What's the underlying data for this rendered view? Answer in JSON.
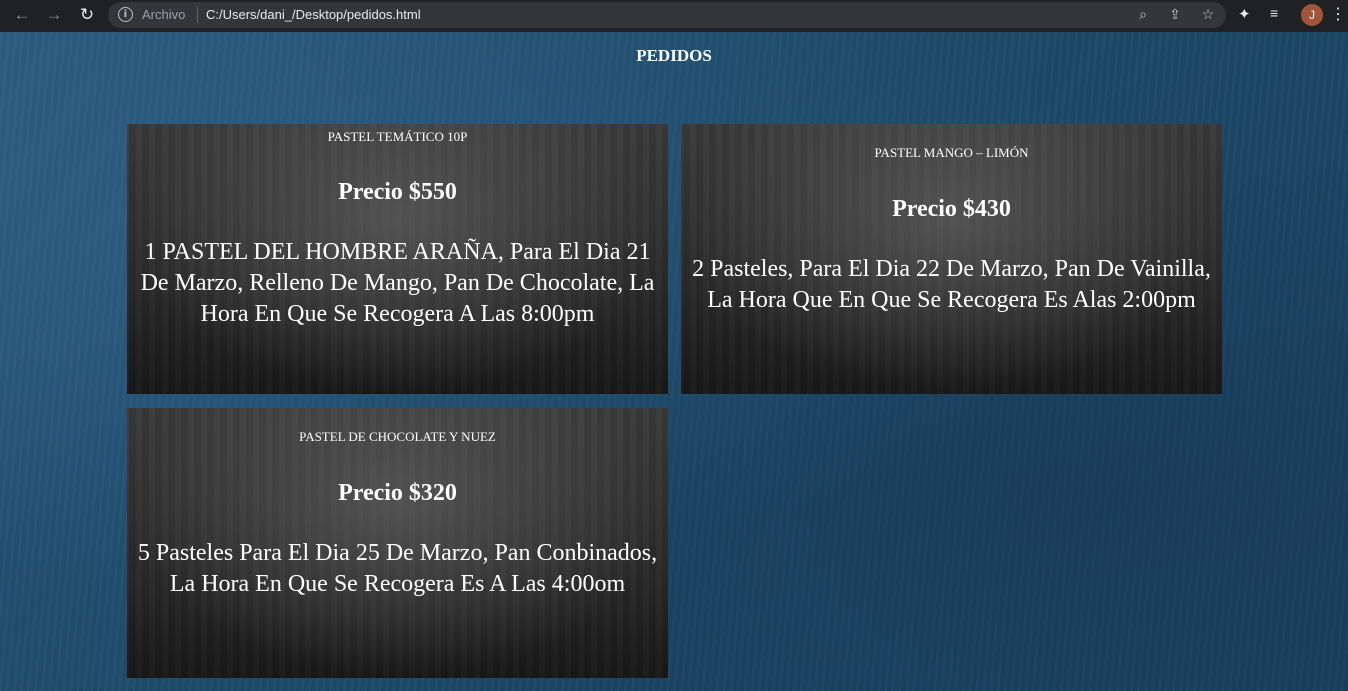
{
  "browser": {
    "back_icon": "←",
    "forward_icon": "→",
    "reload_icon": "↻",
    "info_icon": "i",
    "scheme_label": "Archivo",
    "url": "C:/Users/dani_/Desktop/pedidos.html",
    "zoom_icon": "⌕",
    "share_icon": "⇪",
    "star_icon": "☆",
    "extensions_icon": "✦",
    "media_icon": "≡",
    "avatar_letter": "J",
    "menu_icon": "⋮"
  },
  "page": {
    "title": "PEDIDOS"
  },
  "orders": [
    {
      "title": "PASTEL TEMÁTICO 10P",
      "price": "Precio $550",
      "description": "1 PASTEL DEL HOMBRE ARAÑA, Para El Dia 21 De Marzo, Relleno De Mango, Pan De Chocolate, La Hora En Que Se Recogera A Las 8:00pm"
    },
    {
      "title": "PASTEL MANGO – LIMÓN",
      "price": "Precio $430",
      "description": "2 Pasteles, Para El Dia 22 De Marzo, Pan De Vainilla, La Hora Que En Que Se Recogera Es Alas 2:00pm"
    },
    {
      "title": "PASTEL DE CHOCOLATE Y NUEZ",
      "price": "Precio $320",
      "description": "5 Pasteles Para El Dia 25 De Marzo, Pan Conbinados, La Hora En Que Se Recogera Es A Las 4:00om"
    }
  ]
}
